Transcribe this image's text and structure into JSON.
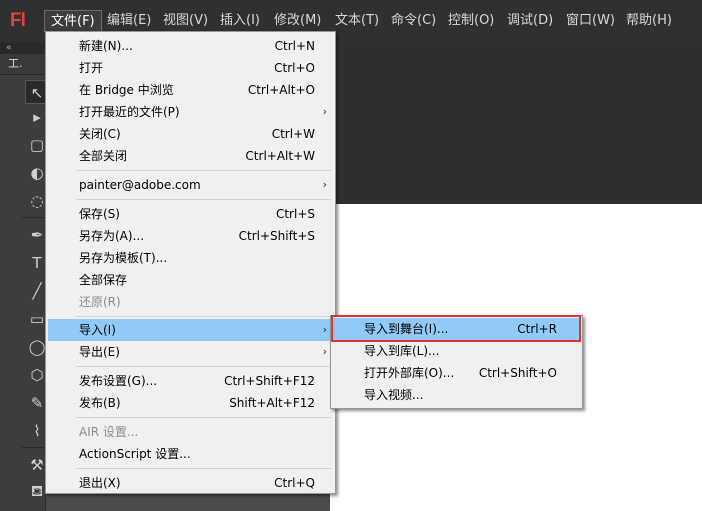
{
  "app": {
    "logo_text": "Fl",
    "brand_color": "#e2403a"
  },
  "menubar": {
    "items": [
      {
        "label": "文件(F)"
      },
      {
        "label": "编辑(E)"
      },
      {
        "label": "视图(V)"
      },
      {
        "label": "插入(I)"
      },
      {
        "label": "修改(M)"
      },
      {
        "label": "文本(T)"
      },
      {
        "label": "命令(C)"
      },
      {
        "label": "控制(O)"
      },
      {
        "label": "调试(D)"
      },
      {
        "label": "窗口(W)"
      },
      {
        "label": "帮助(H)"
      }
    ],
    "active_index": 0
  },
  "tools_panel": {
    "collapse_glyph": "«",
    "header_label": "工.",
    "tools": [
      {
        "icon": "selection-arrow-icon",
        "glyph": "↖"
      },
      {
        "icon": "subselection-arrow-icon",
        "glyph": "▸"
      },
      {
        "icon": "free-transform-icon",
        "glyph": "▢"
      },
      {
        "icon": "3d-rotation-icon",
        "glyph": "◐"
      },
      {
        "icon": "lasso-icon",
        "glyph": "◌"
      },
      {
        "icon": "pen-icon",
        "glyph": "✒"
      },
      {
        "icon": "text-icon",
        "glyph": "T"
      },
      {
        "icon": "line-icon",
        "glyph": "╱"
      },
      {
        "icon": "rectangle-icon",
        "glyph": "▭"
      },
      {
        "icon": "oval-icon",
        "glyph": "◯"
      },
      {
        "icon": "polystar-icon",
        "glyph": "⬡"
      },
      {
        "icon": "pencil-icon",
        "glyph": "✎"
      },
      {
        "icon": "brush-icon",
        "glyph": "⌇"
      },
      {
        "icon": "bone-icon",
        "glyph": "⚒"
      },
      {
        "icon": "paint-bucket-icon",
        "glyph": "⛾"
      }
    ]
  },
  "file_menu": {
    "items": [
      {
        "label": "新建(N)...",
        "shortcut": "Ctrl+N"
      },
      {
        "label": "打开",
        "shortcut": "Ctrl+O"
      },
      {
        "label": "在 Bridge 中浏览",
        "shortcut": "Ctrl+Alt+O"
      },
      {
        "label": "打开最近的文件(P)",
        "shortcut": "",
        "submenu": true
      },
      {
        "label": "关闭(C)",
        "shortcut": "Ctrl+W"
      },
      {
        "label": "全部关闭",
        "shortcut": "Ctrl+Alt+W"
      },
      {
        "label": "painter@adobe.com",
        "shortcut": "",
        "submenu": true
      },
      {
        "label": "保存(S)",
        "shortcut": "Ctrl+S"
      },
      {
        "label": "另存为(A)...",
        "shortcut": "Ctrl+Shift+S"
      },
      {
        "label": "另存为模板(T)...",
        "shortcut": ""
      },
      {
        "label": "全部保存",
        "shortcut": ""
      },
      {
        "label": "还原(R)",
        "shortcut": "",
        "disabled": true
      },
      {
        "label": "导入(I)",
        "shortcut": "",
        "submenu": true,
        "highlighted": true
      },
      {
        "label": "导出(E)",
        "shortcut": "",
        "submenu": true
      },
      {
        "label": "发布设置(G)...",
        "shortcut": "Ctrl+Shift+F12"
      },
      {
        "label": "发布(B)",
        "shortcut": "Shift+Alt+F12"
      },
      {
        "label": "AIR 设置...",
        "shortcut": "",
        "disabled": true
      },
      {
        "label": "ActionScript 设置...",
        "shortcut": ""
      },
      {
        "label": "退出(X)",
        "shortcut": "Ctrl+Q"
      }
    ]
  },
  "import_submenu": {
    "items": [
      {
        "label": "导入到舞台(I)...",
        "shortcut": "Ctrl+R",
        "highlighted": true
      },
      {
        "label": "导入到库(L)...",
        "shortcut": ""
      },
      {
        "label": "打开外部库(O)...",
        "shortcut": "Ctrl+Shift+O"
      },
      {
        "label": "导入视频...",
        "shortcut": ""
      }
    ]
  },
  "colors": {
    "menu_highlight": "#91c9f7",
    "annotation_box": "#e3332c",
    "stage": "#ffffff"
  }
}
